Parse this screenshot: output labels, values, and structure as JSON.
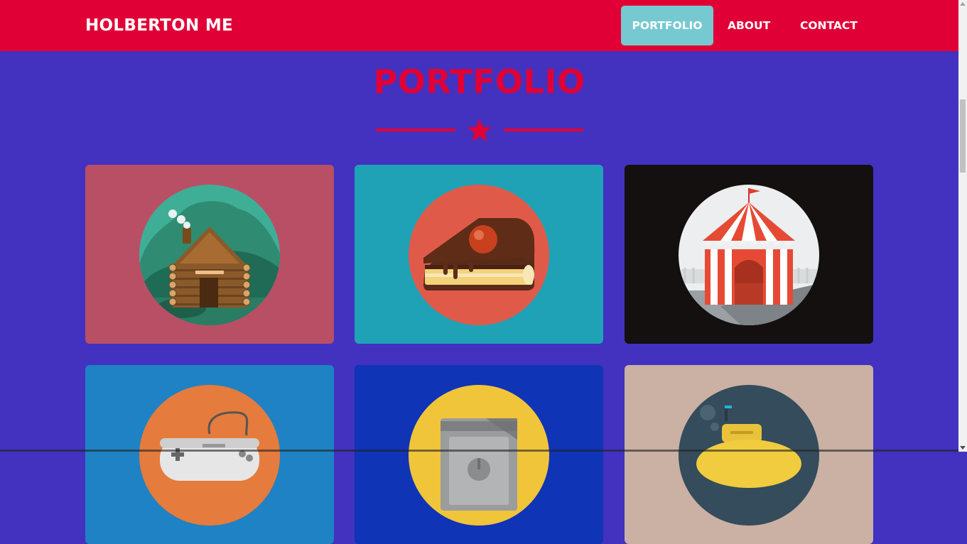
{
  "nav": {
    "brand": "HOLBERTON ME",
    "links": [
      {
        "label": "PORTFOLIO",
        "active": true
      },
      {
        "label": "ABOUT",
        "active": false
      },
      {
        "label": "CONTACT",
        "active": false
      }
    ]
  },
  "portfolio": {
    "title": "PORTFOLIO",
    "cards": [
      {
        "icon": "cabin-icon",
        "bg": "#b94f65"
      },
      {
        "icon": "cake-icon",
        "bg": "#20a2b6"
      },
      {
        "icon": "circus-tent-icon",
        "bg": "#141010"
      },
      {
        "icon": "game-controller-icon",
        "bg": "#1e82c4"
      },
      {
        "icon": "safe-icon",
        "bg": "#1034b6"
      },
      {
        "icon": "submarine-icon",
        "bg": "#cbb0a4"
      }
    ]
  },
  "colors": {
    "nav_bg": "#e10036",
    "page_bg": "#4232bf",
    "accent": "#e10036",
    "active_link_bg": "#76c9d1"
  }
}
